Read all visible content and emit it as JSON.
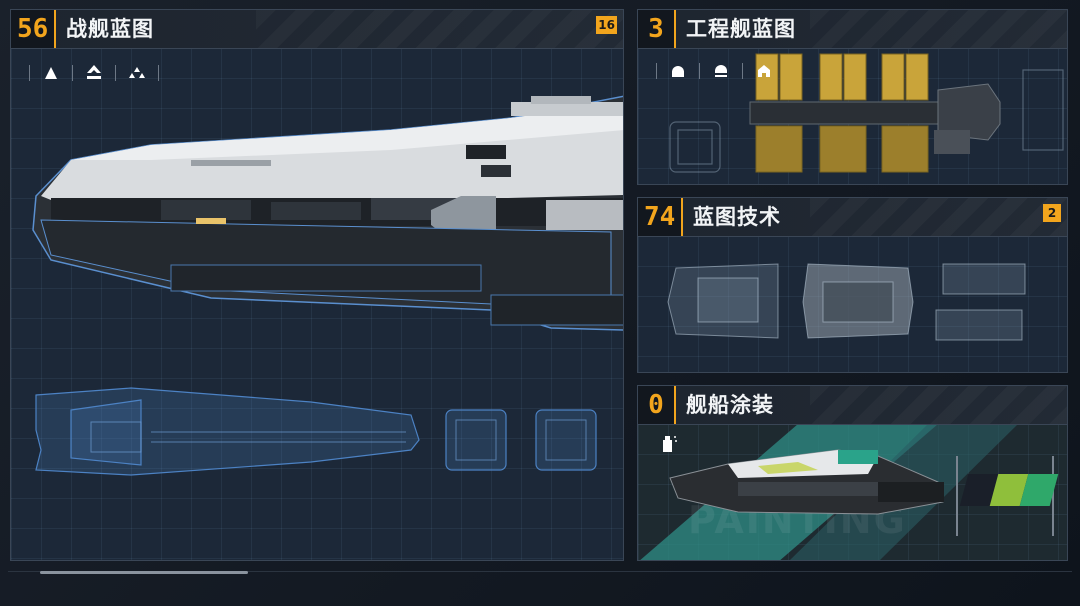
{
  "panels": {
    "warship": {
      "count": "56",
      "title": "战舰蓝图",
      "badge": "16",
      "filters": [
        "triangle-filter-icon",
        "ship-up-filter-icon",
        "triple-triangle-filter-icon"
      ]
    },
    "engineering": {
      "count": "3",
      "title": "工程舰蓝图",
      "filters": [
        "dome-filter-icon",
        "dome-bar-filter-icon",
        "house-filter-icon"
      ]
    },
    "technology": {
      "count": "74",
      "title": "蓝图技术",
      "badge": "2"
    },
    "painting": {
      "count": "0",
      "title": "舰船涂装",
      "watermark": "PAINTING",
      "swatches": [
        "#1a1f29",
        "#8fbf3b",
        "#2fa86a"
      ]
    }
  },
  "colors": {
    "accent": "#f2a51d",
    "panel_border": "#3a4656",
    "blueprint": "#4c82c4"
  }
}
